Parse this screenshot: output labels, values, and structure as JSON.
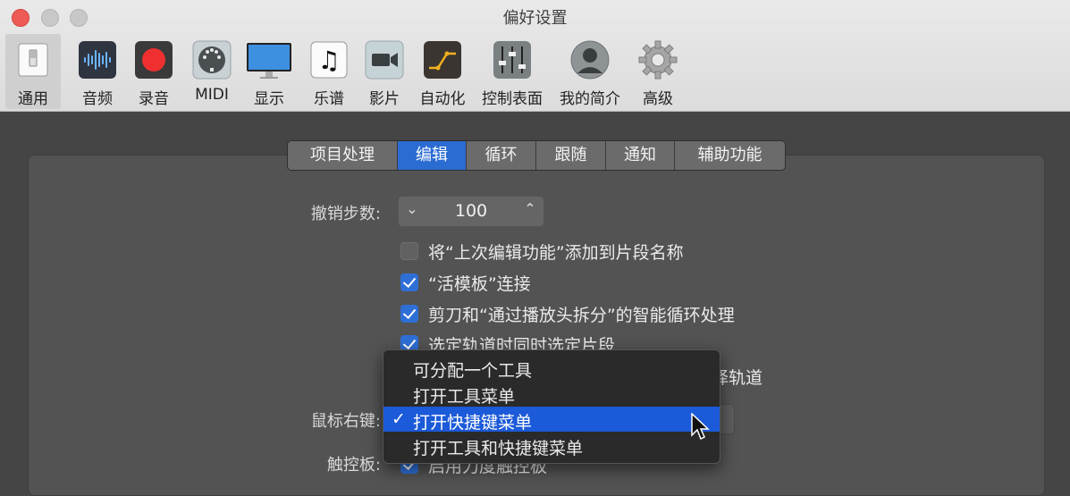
{
  "window": {
    "title": "偏好设置"
  },
  "toolbar": {
    "items": [
      {
        "label": "通用",
        "icon": "general-switch-icon"
      },
      {
        "label": "音频",
        "icon": "audio-waveform-icon"
      },
      {
        "label": "录音",
        "icon": "record-icon"
      },
      {
        "label": "MIDI",
        "icon": "midi-connector-icon"
      },
      {
        "label": "显示",
        "icon": "display-monitor-icon"
      },
      {
        "label": "乐谱",
        "icon": "music-note-icon"
      },
      {
        "label": "影片",
        "icon": "video-camera-icon"
      },
      {
        "label": "自动化",
        "icon": "automation-curve-icon"
      },
      {
        "label": "控制表面",
        "icon": "faders-icon"
      },
      {
        "label": "我的简介",
        "icon": "profile-person-icon"
      },
      {
        "label": "高级",
        "icon": "gear-icon"
      }
    ]
  },
  "tabs": [
    "项目处理",
    "编辑",
    "循环",
    "跟随",
    "通知",
    "辅助功能"
  ],
  "active_tab": "编辑",
  "undo": {
    "label": "撤销步数:",
    "value": "100"
  },
  "checkboxes": [
    {
      "label": "将“上次编辑功能”添加到片段名称",
      "checked": false
    },
    {
      "label": "“活模板”连接",
      "checked": true
    },
    {
      "label": "剪刀和“通过播放头拆分”的智能循环处理",
      "checked": true
    },
    {
      "label": "选定轨道时同时选定片段",
      "checked": true
    }
  ],
  "partial_text": "择轨道",
  "right_click": {
    "label": "鼠标右键:"
  },
  "trackpad": {
    "label": "触控板:",
    "option_label": "启用力度触控板"
  },
  "menu": {
    "items": [
      {
        "label": "可分配一个工具",
        "selected": false
      },
      {
        "label": "打开工具菜单",
        "selected": false
      },
      {
        "label": "打开快捷键菜单",
        "selected": true
      },
      {
        "label": "打开工具和快捷键菜单",
        "selected": false
      }
    ],
    "check_glyph": "✓"
  },
  "colors": {
    "accent": "#2b6cd2",
    "close": "#ee5b55",
    "menu_highlight": "#1b5ad8"
  }
}
